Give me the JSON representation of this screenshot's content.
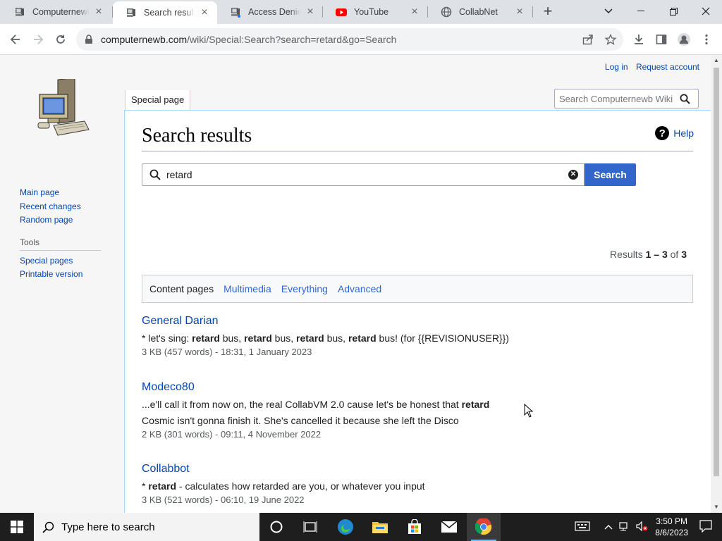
{
  "browser": {
    "tabs": [
      {
        "title": "Computernewb Wiki",
        "icon": "wiki-computer-icon",
        "active": false
      },
      {
        "title": "Search results for",
        "icon": "wiki-computer-icon",
        "active": true
      },
      {
        "title": "Access Denied",
        "icon": "wiki-computer-icon",
        "active": false
      },
      {
        "title": "YouTube",
        "icon": "youtube-icon",
        "active": false
      },
      {
        "title": "CollabNet",
        "icon": "globe-icon",
        "active": false
      }
    ],
    "url_host": "computernewb.com",
    "url_rest": "/wiki/Special:Search?search=retard&go=Search"
  },
  "personal": {
    "login": "Log in",
    "request": "Request account"
  },
  "sidebar": {
    "nav": [
      "Main page",
      "Recent changes",
      "Random page"
    ],
    "tools_heading": "Tools",
    "tools": [
      "Special pages",
      "Printable version"
    ]
  },
  "header": {
    "tab_label": "Special page",
    "search_placeholder": "Search Computernewb Wiki"
  },
  "main": {
    "title": "Search results",
    "help": "Help",
    "query": "retard",
    "search_button": "Search",
    "results_prefix": "Results",
    "results_range": "1 – 3",
    "results_of": "of",
    "results_total": "3",
    "profiles": {
      "current": "Content pages",
      "links": [
        "Multimedia",
        "Everything",
        "Advanced"
      ]
    },
    "results": [
      {
        "title": "General Darian",
        "snippet": [
          [
            "* let's sing: ",
            false
          ],
          [
            "retard",
            true
          ],
          [
            " bus, ",
            false
          ],
          [
            "retard",
            true
          ],
          [
            " bus, ",
            false
          ],
          [
            "retard",
            true
          ],
          [
            " bus, ",
            false
          ],
          [
            "retard",
            true
          ],
          [
            " bus! (for {{REVISIONUSER}})",
            false
          ]
        ],
        "meta": "3 KB (457 words) - 18:31, 1 January 2023"
      },
      {
        "title": "Modeco80",
        "snippet": [
          [
            "...e'll call it from now on, the real CollabVM 2.0 cause let's be honest that ",
            false
          ],
          [
            "retard",
            true
          ],
          [
            " Cosmic isn't gonna finish it. She's cancelled it because she left the Disco",
            false
          ]
        ],
        "meta": "2 KB (301 words) - 09:11, 4 November 2022"
      },
      {
        "title": "Collabbot",
        "snippet": [
          [
            "* ",
            false
          ],
          [
            "retard",
            true
          ],
          [
            " - calculates how retarded are you, or whatever you input",
            false
          ]
        ],
        "meta": "3 KB (521 words) - 06:10, 19 June 2022"
      }
    ]
  },
  "taskbar": {
    "search_placeholder": "Type here to search",
    "time": "3:50 PM",
    "date": "8/6/2023"
  }
}
